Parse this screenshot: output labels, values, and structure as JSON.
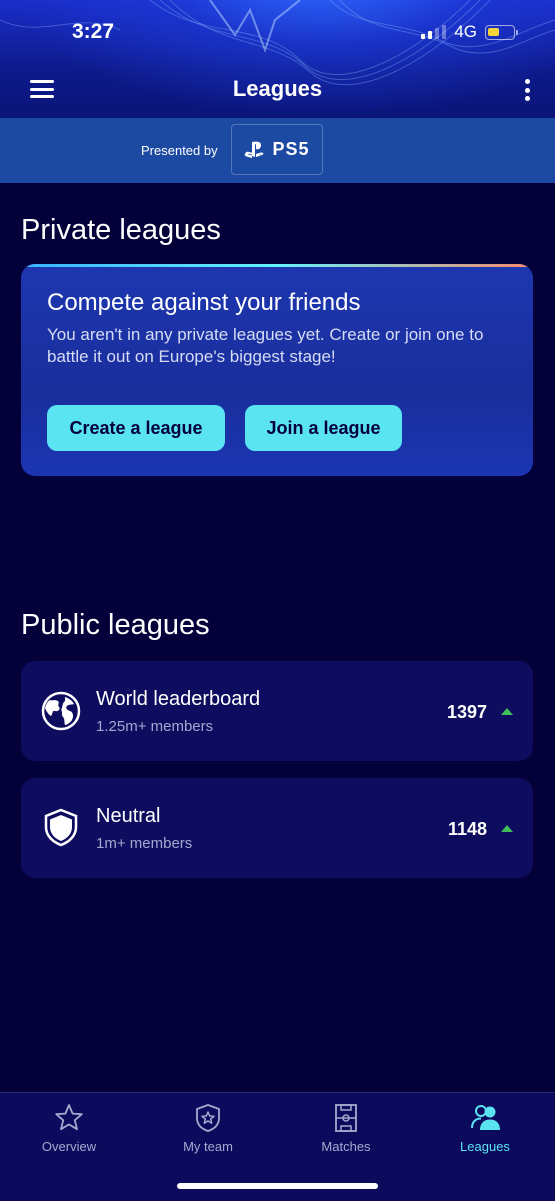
{
  "status_bar": {
    "time": "3:27",
    "network": "4G"
  },
  "header": {
    "title": "Leagues",
    "menu_icon": "hamburger-menu-icon",
    "more_icon": "more-vertical-icon"
  },
  "sponsor": {
    "presented_by": "Presented by",
    "logo_text": "PS5"
  },
  "private_section": {
    "heading": "Private leagues",
    "card_title": "Compete against your friends",
    "card_description": "You aren't in any private leagues yet. Create or join one to battle it out on Europe's biggest stage!",
    "create_label": "Create a league",
    "join_label": "Join a league"
  },
  "public_section": {
    "heading": "Public leagues",
    "leagues": [
      {
        "name": "World leaderboard",
        "members": "1.25m+ members",
        "rank": "1397",
        "icon": "globe-icon",
        "trend": "up"
      },
      {
        "name": "Neutral",
        "members": "1m+ members",
        "rank": "1148",
        "icon": "shield-icon",
        "trend": "up"
      }
    ]
  },
  "tabs": [
    {
      "label": "Overview",
      "icon": "star-icon",
      "active": false
    },
    {
      "label": "My team",
      "icon": "badge-star-icon",
      "active": false
    },
    {
      "label": "Matches",
      "icon": "pitch-icon",
      "active": false
    },
    {
      "label": "Leagues",
      "icon": "users-icon",
      "active": true
    }
  ],
  "colors": {
    "background": "#03003a",
    "accent": "#5ae4f2",
    "card": "#0d0c5e",
    "trend_up": "#3fbf5a"
  }
}
